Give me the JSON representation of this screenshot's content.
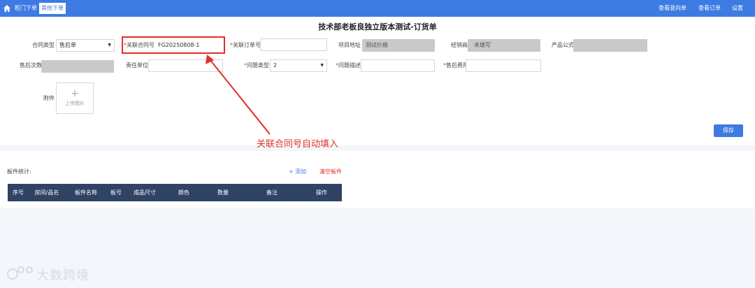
{
  "nav": {
    "tabs": [
      {
        "label": "柜门下单"
      },
      {
        "label": "其他下单"
      }
    ],
    "links": [
      {
        "label": "查看意向单"
      },
      {
        "label": "查看订单"
      },
      {
        "label": "设置"
      }
    ]
  },
  "page_title": "技术部老板良独立版本测试-订货单",
  "form": {
    "contract_type": {
      "label": "合同类型",
      "value": "售后单"
    },
    "linked_contract": {
      "label": "关联合同号",
      "value": "FG20250808-1"
    },
    "linked_order": {
      "label": "关联订单号",
      "value": ""
    },
    "project_address": {
      "label": "项目地址",
      "value": "测试价格"
    },
    "dealer": {
      "label": "经销商",
      "value": "未填写"
    },
    "product_formula": {
      "label": "产品公式",
      "value": ""
    },
    "aftersale_count": {
      "label": "售后次数",
      "value": ""
    },
    "responsible_unit": {
      "label": "责任单位",
      "value": ""
    },
    "issue_type": {
      "label": "问题类型",
      "value": "2"
    },
    "issue_desc": {
      "label": "问题描述",
      "value": ""
    },
    "aftersale_fee": {
      "label": "售后费用",
      "value": ""
    },
    "attachment": {
      "label": "附件",
      "upload_label": "上传图片"
    }
  },
  "save_label": "保存",
  "annotation": "关联合同号自动填入",
  "parts": {
    "stats_label": "板件统计:",
    "add_label": "+ 添加",
    "clear_label": "清空板件",
    "columns": [
      "序号",
      "房间/品名",
      "板件名称",
      "板号",
      "成品尺寸",
      "颜色",
      "数量",
      "备注",
      "操作"
    ]
  },
  "watermark": "大数跨境",
  "colors": {
    "primary": "#3d7be3",
    "annotation": "#e0302a",
    "table_header": "#2f4365"
  }
}
